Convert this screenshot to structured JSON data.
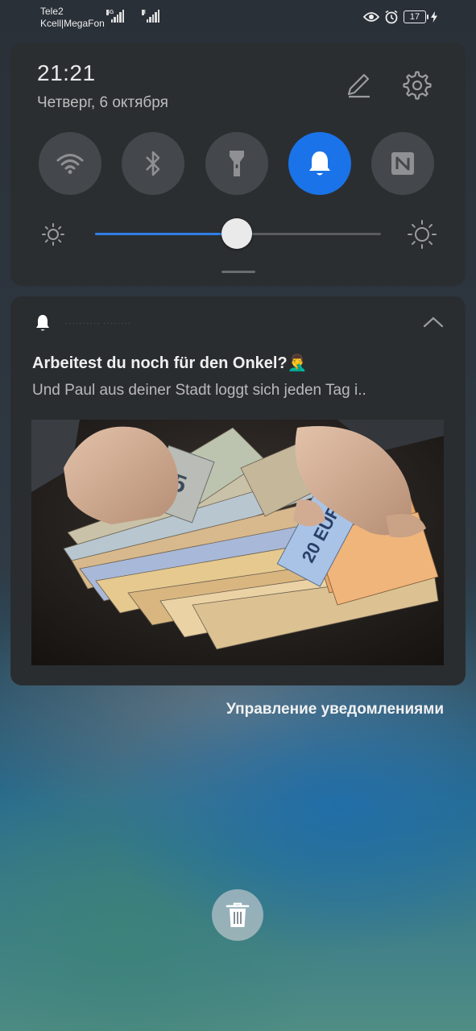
{
  "status_bar": {
    "carrier1": "Tele2",
    "carrier2": "Kcell|MegaFon",
    "network1": "4G",
    "network2": "R",
    "battery": "17",
    "icons": [
      "eye-icon",
      "alarm-icon",
      "battery-icon",
      "charging-icon"
    ]
  },
  "quick_settings": {
    "time": "21:21",
    "date": "Четверг, 6 октября",
    "toggles": [
      {
        "name": "wifi",
        "icon": "wifi-icon",
        "on": false
      },
      {
        "name": "bluetooth",
        "icon": "bluetooth-icon",
        "on": false
      },
      {
        "name": "flashlight",
        "icon": "flashlight-icon",
        "on": false
      },
      {
        "name": "sound",
        "icon": "bell-icon",
        "on": true
      },
      {
        "name": "nfc",
        "icon": "nfc-icon",
        "on": false
      }
    ],
    "brightness_level": 0.495,
    "accent_color": "#1a73e8"
  },
  "notification": {
    "title": "Arbeitest du noch für den Onkel?🤦‍♂️",
    "text": "Und Paul aus deiner Stadt loggt sich jeden Tag i..",
    "image_icon": "money-photo",
    "banknote_labels": [
      "5",
      "20 EURO"
    ]
  },
  "footer": {
    "manage_label": "Управление уведомлениями",
    "clear_icon": "trash-icon"
  }
}
